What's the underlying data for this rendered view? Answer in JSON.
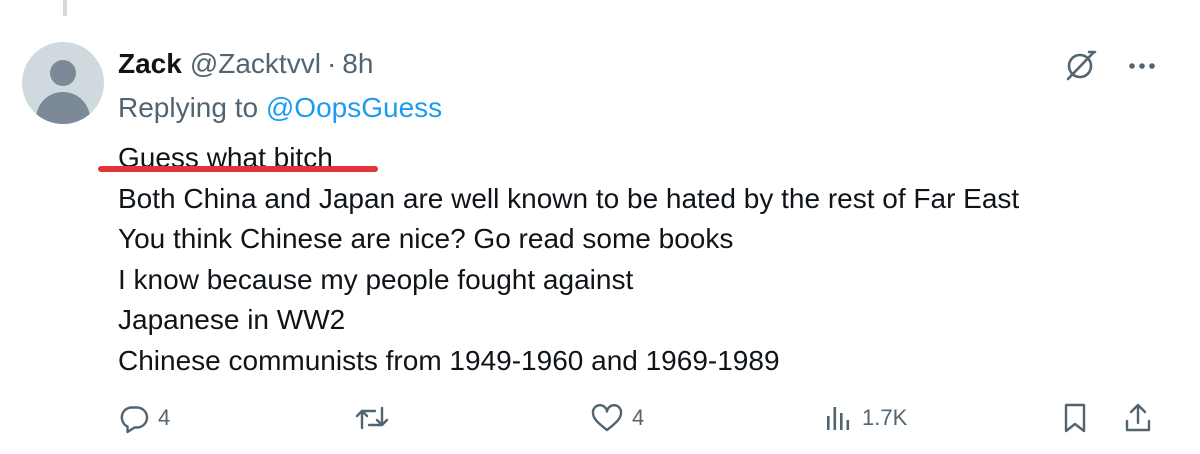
{
  "author": {
    "display_name": "Zack",
    "handle": "@Zacktvvl",
    "separator": "·",
    "time": "8h"
  },
  "replying": {
    "prefix": "Replying to",
    "mention": "@OopsGuess"
  },
  "content": {
    "lines": [
      "Guess what bitch",
      "Both China and Japan are well known to be hated by the rest of Far East",
      "You think Chinese are nice? Go read some books",
      "I know because my people fought against",
      "Japanese in WW2",
      "Chinese communists from 1949-1960 and 1969-1989"
    ],
    "highlight_color": "#e4343b"
  },
  "actions": {
    "replies": "4",
    "reposts": "",
    "likes": "4",
    "views": "1.7K"
  },
  "icons": {
    "header": [
      "grok-icon",
      "more-icon"
    ],
    "actions": [
      "reply-icon",
      "repost-icon",
      "like-icon",
      "views-icon",
      "bookmark-icon",
      "share-icon"
    ]
  },
  "colors": {
    "text": "#0f1419",
    "secondary": "#536471",
    "link": "#1d9bf0",
    "thread_line": "#cfd9de",
    "background": "#ffffff"
  }
}
